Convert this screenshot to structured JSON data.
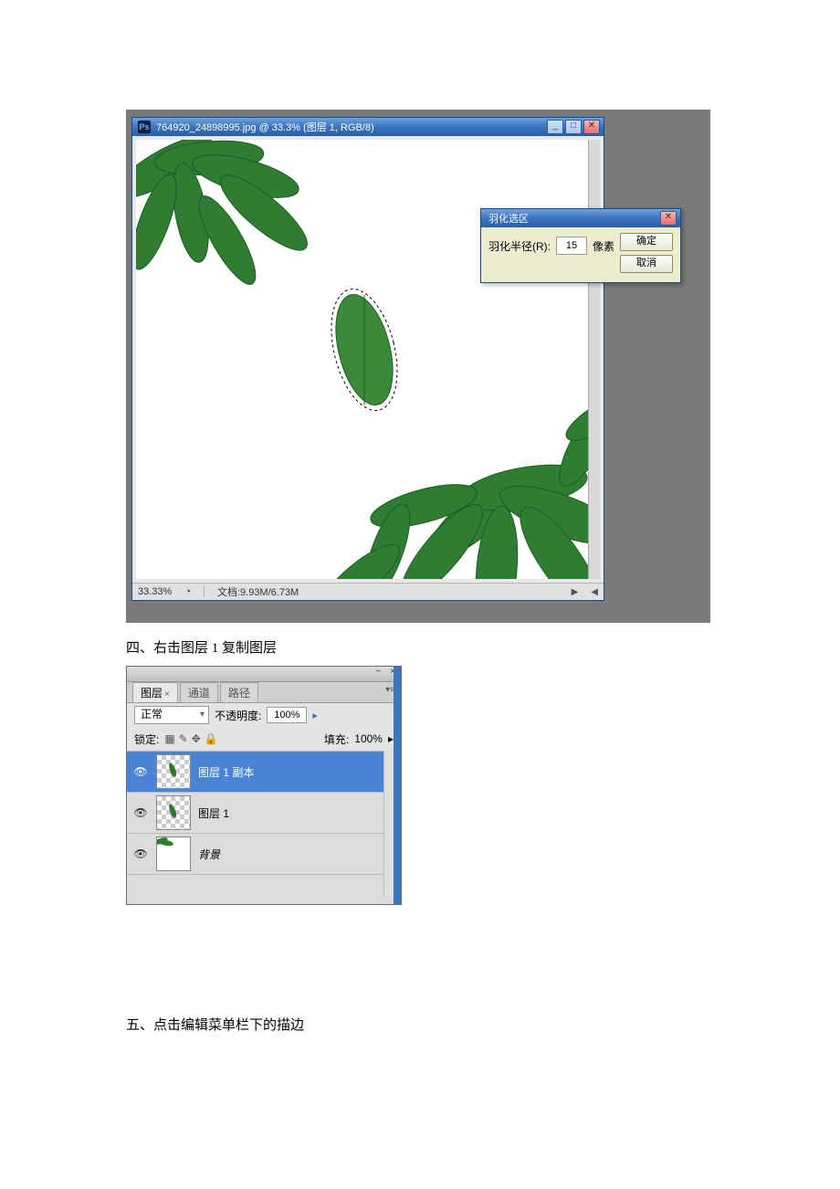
{
  "doc_window": {
    "title": "764920_24898995.jpg @ 33.3% (图层 1, RGB/8)",
    "zoom": "33.33%",
    "doc_size": "文档:9.93M/6.73M"
  },
  "feather_dialog": {
    "title": "羽化选区",
    "radius_label": "羽化半径(R):",
    "radius_value": "15",
    "unit": "像素",
    "ok": "确定",
    "cancel": "取消"
  },
  "step4_caption": "四、右击图层 1 复制图层",
  "layers_panel": {
    "tabs": {
      "layers": "图层",
      "channels": "通道",
      "paths": "路径"
    },
    "blend_mode": "正常",
    "opacity_label": "不透明度:",
    "opacity_value": "100%",
    "lock_label": "锁定:",
    "fill_label": "填充:",
    "fill_value": "100%",
    "rows": [
      {
        "name": "图层 1 副本"
      },
      {
        "name": "图层 1"
      },
      {
        "name": "背景"
      }
    ]
  },
  "step5_caption": "五、点击编辑菜单栏下的描边"
}
